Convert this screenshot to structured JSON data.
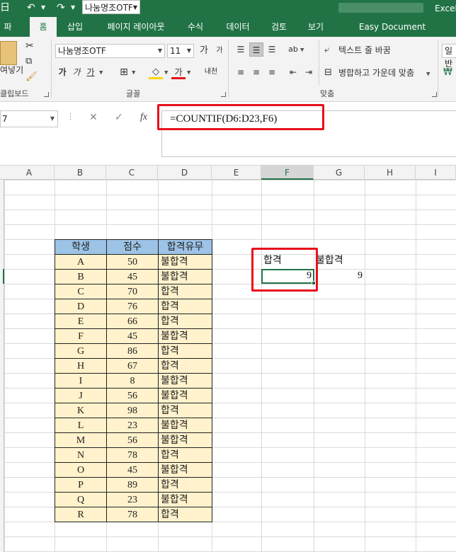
{
  "titlebar": {
    "save_glyph": "日",
    "undo_glyph": "↶",
    "redo_glyph": "↷",
    "font_name": "나눔명조OTF",
    "app_name": "Excel"
  },
  "tabs": [
    {
      "label": "파일"
    },
    {
      "label": "홈"
    },
    {
      "label": "삽입"
    },
    {
      "label": "페이지 레이아웃"
    },
    {
      "label": "수식"
    },
    {
      "label": "데이터"
    },
    {
      "label": "검토"
    },
    {
      "label": "보기"
    },
    {
      "label": "Easy Document Creator"
    }
  ],
  "ribbon": {
    "paste_label": "여넣기",
    "clipboard_label": "클립보드",
    "font_label": "글꼴",
    "align_label": "맞춤",
    "font_name": "나눔명조OTF",
    "font_size": "11",
    "grow_font": "가",
    "shrink_font": "가",
    "bold": "가",
    "italic": "가",
    "underline": "가",
    "font_color": "가",
    "phonetic": "내천",
    "wrap_text": "텍스트 줄 바꿈",
    "merge_center": "병합하고 가운데 맞춤",
    "number_format": "일반"
  },
  "formula_bar": {
    "name_box": "7",
    "cancel_glyph": "✕",
    "enter_glyph": "✓",
    "fx_glyph": "fx",
    "formula": "=COUNTIF(D6:D23,F6)"
  },
  "columns": [
    "A",
    "B",
    "C",
    "D",
    "E",
    "F",
    "G",
    "H",
    "I"
  ],
  "table": {
    "headers": [
      "학생",
      "점수",
      "합격유무"
    ],
    "rows": [
      [
        "A",
        "50",
        "불합격"
      ],
      [
        "B",
        "45",
        "불합격"
      ],
      [
        "C",
        "70",
        "합격"
      ],
      [
        "D",
        "76",
        "합격"
      ],
      [
        "E",
        "66",
        "합격"
      ],
      [
        "F",
        "45",
        "불합격"
      ],
      [
        "G",
        "86",
        "합격"
      ],
      [
        "H",
        "67",
        "합격"
      ],
      [
        "I",
        "8",
        "불합격"
      ],
      [
        "J",
        "56",
        "불합격"
      ],
      [
        "K",
        "98",
        "합격"
      ],
      [
        "L",
        "23",
        "불합격"
      ],
      [
        "M",
        "56",
        "불합격"
      ],
      [
        "N",
        "78",
        "합격"
      ],
      [
        "O",
        "45",
        "불합격"
      ],
      [
        "P",
        "89",
        "합격"
      ],
      [
        "Q",
        "23",
        "불합격"
      ],
      [
        "R",
        "78",
        "합격"
      ]
    ]
  },
  "summary": {
    "pass_label": "합격",
    "fail_label": "불합격",
    "pass_count": "9",
    "fail_count": "9"
  },
  "colors": {
    "excel_green": "#217346",
    "header_blue": "#9dc3e6",
    "cell_yellow": "#fff2cc",
    "highlight_red": "#e8101c"
  }
}
